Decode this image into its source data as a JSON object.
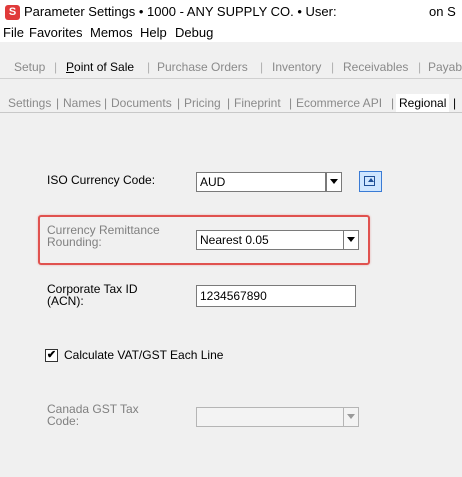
{
  "window": {
    "app_icon_glyph": "S",
    "title": "Parameter Settings  •  1000 - ANY SUPPLY CO.  •  User:",
    "title_overflow": "on S"
  },
  "menu": {
    "items": [
      "File",
      "Favorites",
      "Memos",
      "Help",
      "Debug"
    ]
  },
  "main_tabs": {
    "items": [
      {
        "label": "Setup",
        "active": false
      },
      {
        "label": "Point of Sale",
        "active": true
      },
      {
        "label": "Purchase Orders",
        "active": false
      },
      {
        "label": "Inventory",
        "active": false
      },
      {
        "label": "Receivables",
        "active": false
      },
      {
        "label": "Payab",
        "active": false
      }
    ]
  },
  "sub_tabs": {
    "items": [
      {
        "label": "Settings",
        "active": false
      },
      {
        "label": "Names",
        "active": false
      },
      {
        "label": "Documents",
        "active": false
      },
      {
        "label": "Pricing",
        "active": false
      },
      {
        "label": "Fineprint",
        "active": false
      },
      {
        "label": "Ecommerce API",
        "active": false
      },
      {
        "label": "Regional",
        "active": true
      }
    ]
  },
  "form": {
    "iso_currency": {
      "label": "ISO Currency Code:",
      "value": "AUD"
    },
    "rounding": {
      "label_line1": "Currency Remittance",
      "label_line2": "Rounding:",
      "value": "Nearest 0.05"
    },
    "tax_id": {
      "label_line1": "Corporate Tax ID",
      "label_line2": "(ACN):",
      "value": "1234567890"
    },
    "vat_checkbox": {
      "label": "Calculate VAT/GST Each Line",
      "checked": true,
      "check_glyph": "✔"
    },
    "canada_gst": {
      "label_line1": "Canada GST Tax",
      "label_line2": "Code:",
      "value": ""
    }
  },
  "colors": {
    "highlight": "#e0524f",
    "app_icon": "#e03a3a"
  }
}
